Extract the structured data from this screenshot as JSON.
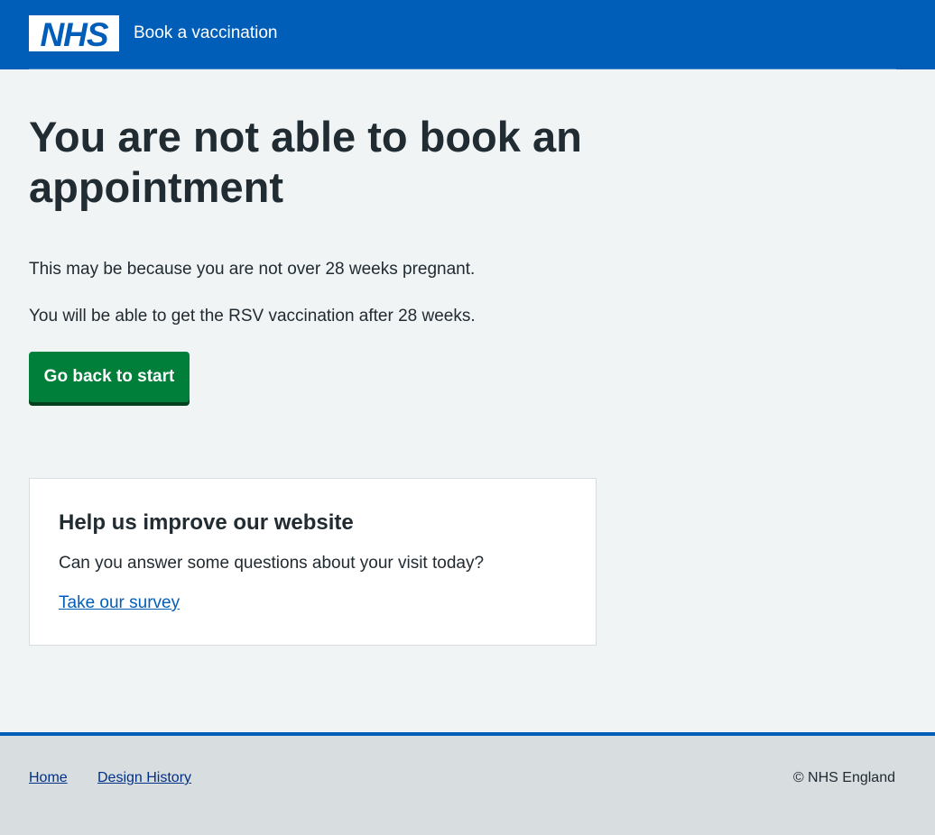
{
  "header": {
    "logo_text": "NHS",
    "service_name": "Book a vaccination"
  },
  "main": {
    "title": "You are not able to book an appointment",
    "paragraphs": [
      "This may be because you are not over 28 weeks pregnant.",
      "You will be able to get the RSV vaccination after 28 weeks."
    ],
    "button_label": "Go back to start"
  },
  "feedback": {
    "title": "Help us improve our website",
    "text": "Can you answer some questions about your visit today?",
    "link_label": "Take our survey"
  },
  "footer": {
    "links": [
      "Home",
      "Design History"
    ],
    "copyright": "© NHS England"
  },
  "colors": {
    "nhs_blue": "#005eb8",
    "button_green": "#007f3b",
    "background": "#f0f4f5",
    "footer_bg": "#d8dde0"
  }
}
